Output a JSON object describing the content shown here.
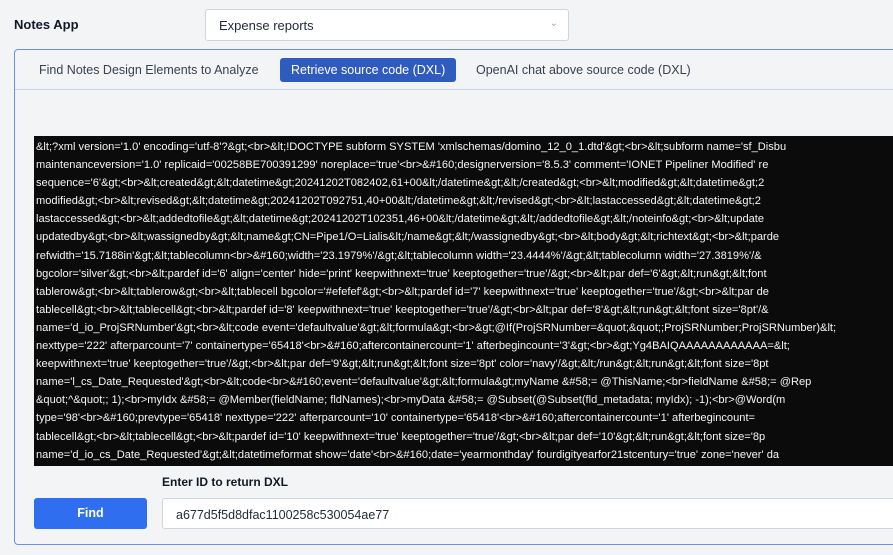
{
  "header": {
    "app_label": "Notes App",
    "database_select": {
      "selected": "Expense reports",
      "chevron_icon": "chevron-down-icon"
    }
  },
  "tabs": [
    {
      "label": "Find Notes Design Elements to Analyze",
      "active": false
    },
    {
      "label": "Retrieve source code (DXL)",
      "active": true
    },
    {
      "label": "OpenAI chat above source code (DXL)",
      "active": false
    }
  ],
  "source": {
    "lines": [
      "&lt;?xml version='1.0' encoding='utf-8'?&gt;<br>&lt;!DOCTYPE subform SYSTEM 'xmlschemas/domino_12_0_1.dtd'&gt;<br>&lt;subform name='sf_Disbu",
      "maintenanceversion='1.0' replicaid='00258BE700391299' noreplace='true'<br>&#160;designerversion='8.5.3' comment='IONET Pipeliner Modified' re",
      "sequence='6'&gt;<br>&lt;created&gt;&lt;datetime&gt;20241202T082402,61+00&lt;/datetime&gt;&lt;/created&gt;<br>&lt;modified&gt;&lt;datetime&gt;2",
      "modified&gt;<br>&lt;revised&gt;&lt;datetime&gt;20241202T092751,40+00&lt;/datetime&gt;&lt;/revised&gt;<br>&lt;lastaccessed&gt;&lt;datetime&gt;2",
      "lastaccessed&gt;<br>&lt;addedtofile&gt;&lt;datetime&gt;20241202T102351,46+00&lt;/datetime&gt;&lt;/addedtofile&gt;&lt;/noteinfo&gt;<br>&lt;update",
      "updatedby&gt;<br>&lt;wassignedby&gt;&lt;name&gt;CN=Pipe1/O=Lialis&lt;/name&gt;&lt;/wassignedby&gt;<br>&lt;body&gt;&lt;richtext&gt;<br>&lt;parde",
      "refwidth='15.7188in'&gt;&lt;tablecolumn<br>&#160;width='23.1979%'/&gt;&lt;tablecolumn width='23.4444%'/&gt;&lt;tablecolumn width='27.3819%'/&",
      "bgcolor='silver'&gt;<br>&lt;pardef id='6' align='center' hide='print' keepwithnext='true' keeptogether='true'/&gt;<br>&lt;par def='6'&gt;&lt;run&gt;&lt;font",
      "tablerow&gt;<br>&lt;tablerow&gt;<br>&lt;tablecell bgcolor='#efefef'&gt;<br>&lt;pardef id='7' keepwithnext='true' keeptogether='true'/&gt;<br>&lt;par de",
      "tablecell&gt;<br>&lt;tablecell&gt;<br>&lt;pardef id='8' keepwithnext='true' keeptogether='true'/&gt;<br>&lt;par def='8'&gt;&lt;run&gt;&lt;font size='8pt'/&",
      "name='d_io_ProjSRNumber'&gt;<br>&lt;code event='defaultvalue'&gt;&lt;formula&gt;<br>&gt;@If(ProjSRNumber=&quot;&quot;;ProjSRNumber;ProjSRNumber)&lt;",
      "nexttype='222' afterparcount='7' containertype='65418'<br>&#160;aftercontainercount='1' afterbegincount='3'&gt;<br>&gt;Yg4BAIQAAAAAAAAAAAA=&lt;",
      "keepwithnext='true' keeptogether='true'/&gt;<br>&lt;par def='9'&gt;&lt;run&gt;&lt;font size='8pt' color='navy'/&gt;&lt;/run&gt;&lt;run&gt;&lt;font size='8pt",
      "name='l_cs_Date_Requested'&gt;<br>&lt;code<br>&#160;event='defaultvalue'&gt;&lt;formula&gt;myName &#58;= @ThisName;<br>fieldName &#58;= @Rep",
      "&quot;^&quot;; 1);<br>myIdx &#58;= @Member(fieldName; fldNames);<br>myData &#58;= @Subset(@Subset(fld_metadata; myIdx); -1);<br>@Word(m",
      "type='98'<br>&#160;prevtype='65418' nexttype='222' afterparcount='10' containertype='65418'<br>&#160;aftercontainercount='1' afterbegincount=",
      "tablecell&gt;<br>&lt;tablecell&gt;<br>&lt;pardef id='10' keepwithnext='true' keeptogether='true'/&gt;<br>&lt;par def='10'&gt;&lt;run&gt;&lt;font size='8p",
      "name='d_io_cs_Date_Requested'&gt;&lt;datetimeformat show='date'<br>&#160;date='yearmonthday' fourdigityearfor21stcentury='true' zone='never' da"
    ]
  },
  "lookup": {
    "label": "Enter ID to return DXL",
    "input_value": "a677d5f5d8dfac1100258c530054ae77",
    "find_label": "Find"
  }
}
